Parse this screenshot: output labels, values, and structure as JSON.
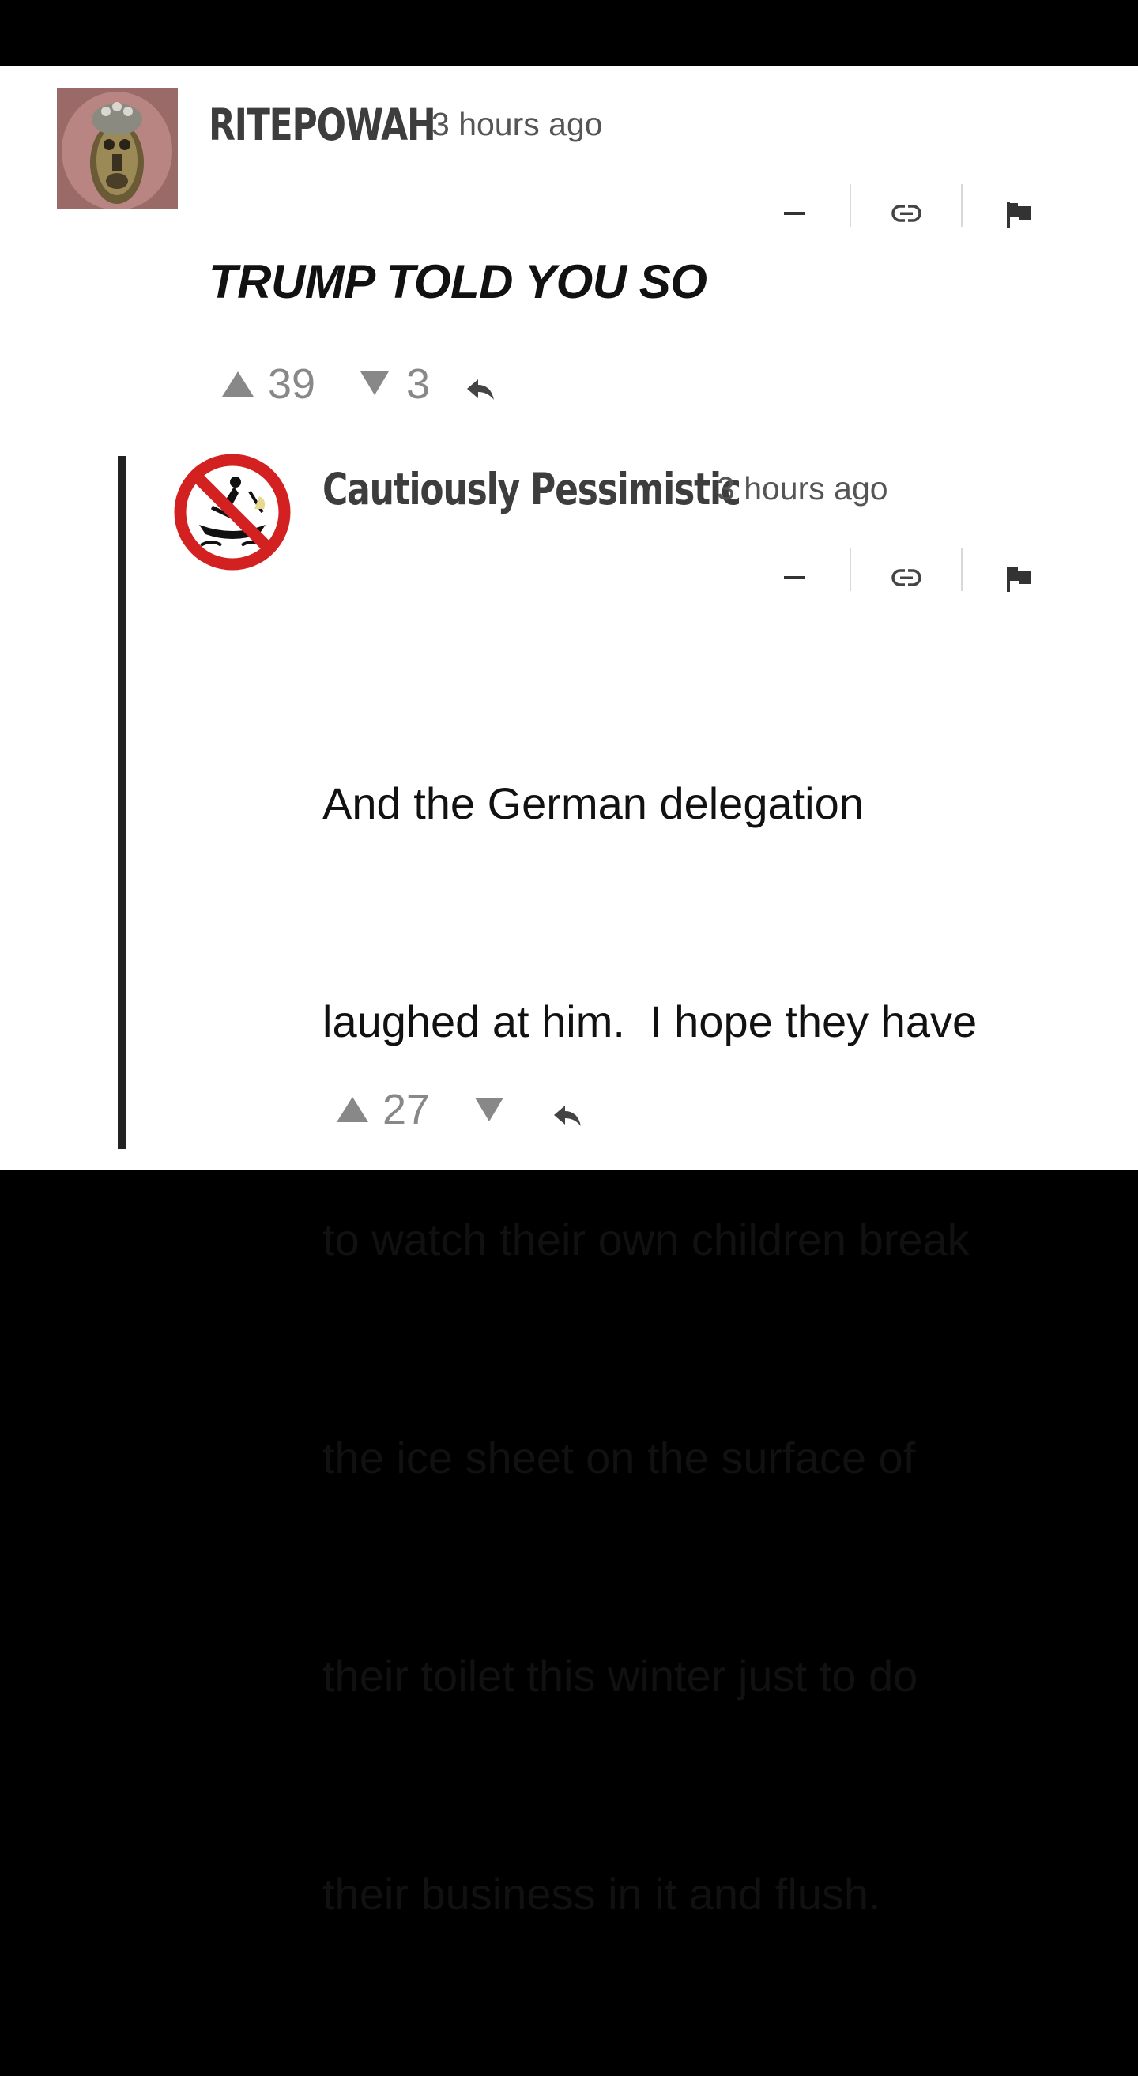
{
  "comments": [
    {
      "username": "RITEPOWAH",
      "timestamp": "3 hours ago",
      "body": "TRUMP TOLD YOU SO",
      "upvotes": "39",
      "downvotes": "3",
      "avatar_icon": "lion-ring-avatar"
    },
    {
      "username": "Cautiously Pessimistic",
      "timestamp": "3 hours ago",
      "body_lines": [
        "And the German delegation",
        "laughed at him.  I hope they have",
        "to watch their own children break",
        "the ice sheet on the surface of",
        "their toilet this winter just to do",
        "their business in it and flush."
      ],
      "upvotes": "27",
      "downvotes": "",
      "avatar_icon": "no-boating-sign-avatar"
    }
  ],
  "icons": [
    "collapse-icon",
    "link-icon",
    "flag-icon",
    "upvote-icon",
    "downvote-icon",
    "reply-icon"
  ],
  "colors": {
    "background": "#ffffff",
    "frame": "#000000",
    "thread_line": "#222222",
    "vote_gray": "#888888",
    "no_sign_red": "#d32020"
  }
}
